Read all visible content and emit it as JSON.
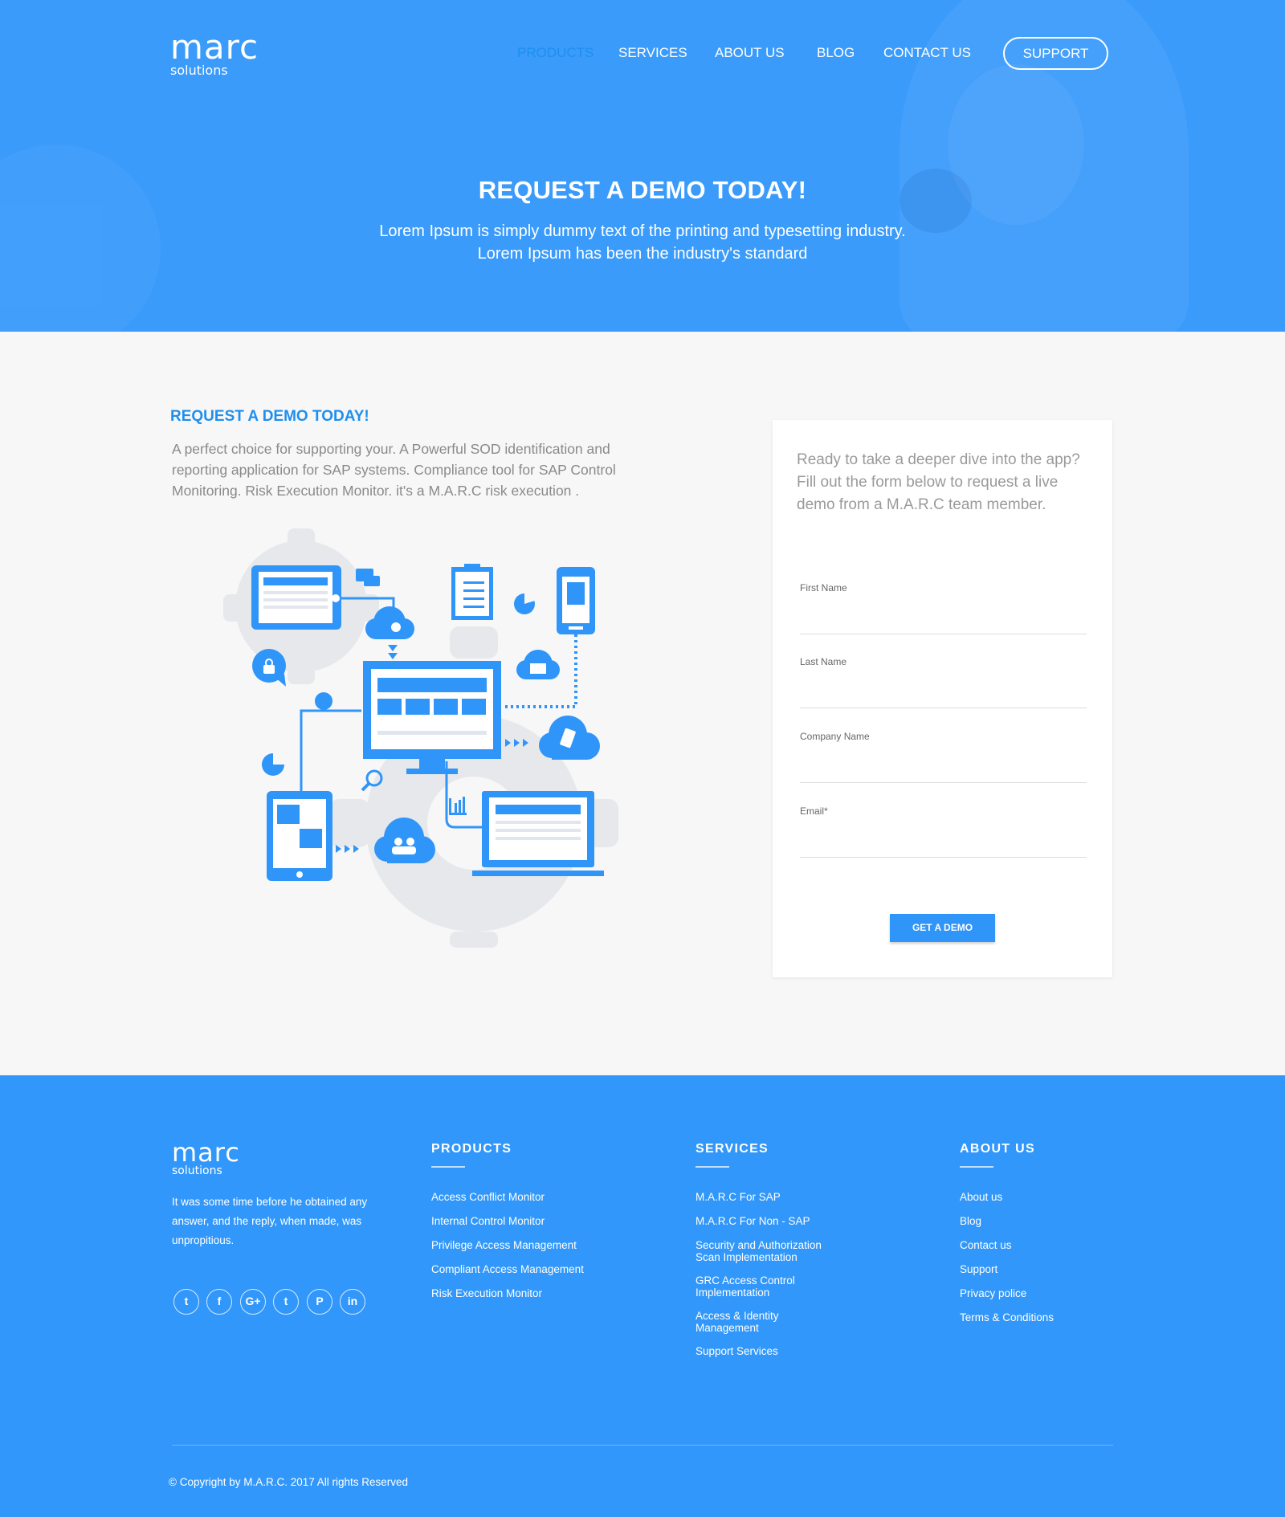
{
  "brand": {
    "logo_mark": "marc",
    "logo_sub": "solutions"
  },
  "nav": {
    "items": [
      "PRODUCTS",
      "SERVICES",
      "ABOUT US",
      "BLOG",
      "CONTACT US"
    ],
    "support": "SUPPORT",
    "active": "PRODUCTS"
  },
  "hero": {
    "title": "REQUEST A DEMO TODAY!",
    "subtitle": "Lorem Ipsum is simply dummy text of the printing and typesetting industry. Lorem Ipsum has been the industry's standard"
  },
  "main": {
    "title": "REQUEST A DEMO TODAY!",
    "description": "A perfect choice for supporting your. A Powerful SOD identification and reporting application for SAP systems. Compliance tool for SAP Control Monitoring. Risk Execution Monitor. it's a M.A.R.C risk execution ."
  },
  "form": {
    "intro": "Ready to take a deeper dive into the app? Fill out the form below to request a live demo from a M.A.R.C team member.",
    "fields": [
      {
        "label": "First Name",
        "value": ""
      },
      {
        "label": "Last Name",
        "value": ""
      },
      {
        "label": "Company Name",
        "value": ""
      },
      {
        "label": "Email*",
        "value": ""
      }
    ],
    "button": "GET A DEMO"
  },
  "footer": {
    "about": "It was some time before he obtained any answer, and the reply, when made, was unpropitious.",
    "socials": [
      "twitter-icon",
      "facebook-icon",
      "google-plus-icon",
      "tumblr-icon",
      "pinterest-icon",
      "linkedin-icon"
    ],
    "social_glyphs": [
      "t",
      "f",
      "G+",
      "t",
      "P",
      "in"
    ],
    "products": {
      "heading": "PRODUCTS",
      "links": [
        "Access Conflict Monitor",
        "Internal Control Monitor",
        "Privilege Access Management",
        "Compliant Access Management",
        "Risk Execution Monitor"
      ]
    },
    "services": {
      "heading": "SERVICES",
      "links": [
        "M.A.R.C For SAP",
        "M.A.R.C For Non - SAP",
        "Security and Authorization\nScan Implementation",
        "GRC Access Control\nImplementation",
        "Access & Identity\nManagement",
        "Support Services"
      ]
    },
    "about_us": {
      "heading": "ABOUT US",
      "links": [
        "About us",
        "Blog",
        "Contact us",
        "Support",
        "Privacy police",
        "Terms & Conditions"
      ]
    },
    "copyright": "© Copyright by M.A.R.C. 2017 All rights Reserved"
  },
  "colors": {
    "primary": "#3a9bfb",
    "accent": "#1e8fee",
    "background": "#f7f7f7",
    "illustration_gear": "#e6e8ec"
  }
}
